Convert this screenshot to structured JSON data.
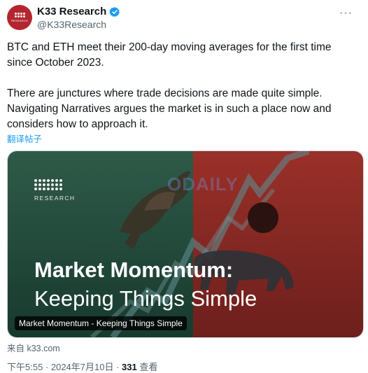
{
  "author": {
    "name": "K33 Research",
    "handle": "@K33Research",
    "avatar_label": "RESEARCH"
  },
  "tweet": {
    "text": "BTC and ETH meet their 200-day moving averages for the first time since October 2023.\n\nThere are junctures where trade decisions are made quite simple. Navigating Narratives argues the market is in such a place now and considers how to approach it.",
    "translate_label": "翻译帖子"
  },
  "card": {
    "logo_label": "RESEARCH",
    "watermark": "ODAILY",
    "headline_line1": "Market Momentum:",
    "headline_line2": "Keeping Things Simple",
    "caption": "Market Momentum - Keeping Things Simple",
    "source": "来自 k33.com"
  },
  "meta": {
    "time": "下午5:55 · 2024年7月10日 · ",
    "views_count": "331",
    "views_label": " 查看"
  },
  "colors": {
    "accent": "#1d9bf0",
    "card_left": "#1f4a3c",
    "card_right": "#8d2a26",
    "avatar": "#b3262f"
  }
}
